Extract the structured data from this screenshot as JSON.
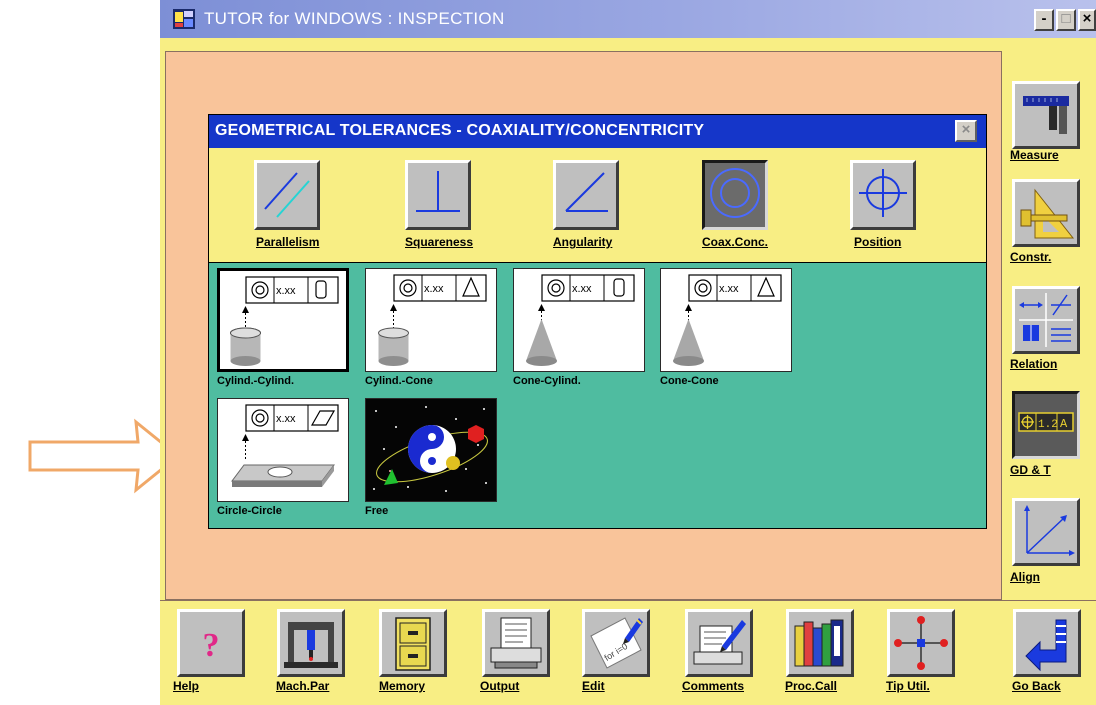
{
  "window": {
    "title": "TUTOR for WINDOWS : INSPECTION",
    "controls": {
      "minimize": "-",
      "maximize": "□",
      "close": "×"
    }
  },
  "dialog": {
    "title": "GEOMETRICAL TOLERANCES - COAXIALITY/CONCENTRICITY",
    "close": "×",
    "categories": [
      {
        "label": "Parallelism",
        "icon": "parallelism-icon"
      },
      {
        "label": "Squareness",
        "icon": "squareness-icon"
      },
      {
        "label": "Angularity",
        "icon": "angularity-icon"
      },
      {
        "label": "Coax.Conc.",
        "icon": "coaxiality-icon",
        "selected": true
      },
      {
        "label": "Position",
        "icon": "position-icon"
      }
    ],
    "options": [
      {
        "label": "Cylind.-Cylind.",
        "frame_value": "x.xx",
        "selected": true
      },
      {
        "label": "Cylind.-Cone",
        "frame_value": "x.xx"
      },
      {
        "label": "Cone-Cylind.",
        "frame_value": "x.xx"
      },
      {
        "label": "Cone-Cone",
        "frame_value": "x.xx"
      },
      {
        "label": "Circle-Circle",
        "frame_value": "x.xx"
      },
      {
        "label": "Free"
      }
    ]
  },
  "right_toolbar": [
    {
      "label": "Measure",
      "icon": "caliper-icon"
    },
    {
      "label": "Constr.",
      "icon": "construction-icon"
    },
    {
      "label": "Relation",
      "icon": "relation-icon"
    },
    {
      "label": "GD & T",
      "icon": "gdt-icon",
      "pressed": true,
      "icon_text": "⊕|1.2|A"
    },
    {
      "label": "Align",
      "icon": "align-icon"
    }
  ],
  "bottom_toolbar": [
    {
      "label": "Help",
      "icon": "help-icon",
      "glyph": "?"
    },
    {
      "label": "Mach.Par",
      "icon": "machine-icon"
    },
    {
      "label": "Memory",
      "icon": "file-cabinet-icon"
    },
    {
      "label": "Output",
      "icon": "printer-icon"
    },
    {
      "label": "Edit",
      "icon": "pen-icon",
      "glyph_text": "for i=0"
    },
    {
      "label": "Comments",
      "icon": "comment-icon"
    },
    {
      "label": "Proc.Call",
      "icon": "books-icon"
    },
    {
      "label": "Tip Util.",
      "icon": "probe-tip-icon"
    },
    {
      "label": "Go Back",
      "icon": "go-back-icon"
    }
  ],
  "colors": {
    "window_bg": "#f8ee84",
    "main_area": "#f9c49a",
    "dialog_title": "#1536c9",
    "options_bg": "#4fbca0",
    "arrow": "#f0a868"
  }
}
